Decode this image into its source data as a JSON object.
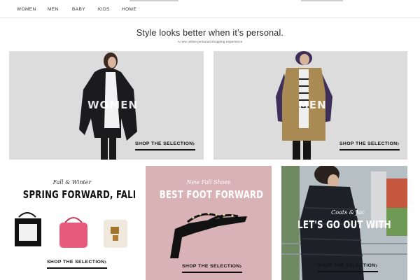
{
  "nav": {
    "items": [
      "WOMEN",
      "MEN",
      "BABY",
      "KIDS",
      "HOME"
    ]
  },
  "hero": {
    "headline": "Style looks better when it’s personal.",
    "subline": "A new online personal shopping experience"
  },
  "panels": {
    "women": {
      "title": "WOMEN",
      "cta": "SHOP THE SELECTION"
    },
    "men": {
      "title": "MEN",
      "cta": "SHOP THE SELECTION"
    }
  },
  "cards": {
    "bags": {
      "script": "Fall & Winter",
      "title": "SPRING FORWARD, FALL BAG",
      "cta": "SHOP THE SELECTION"
    },
    "shoes": {
      "script": "New Fall Shoes",
      "title": "BEST FOOT FORWARD",
      "cta": "SHOP THE SELECTION"
    },
    "coats": {
      "script": "Coats & Jac",
      "title": "LET'S GO OUT WITH",
      "cta": "SHOP THE SELECTION"
    }
  },
  "colors": {
    "panel_gray": "#dcdcdc",
    "shoes_pink": "#d9b2b5",
    "coat_black": "#1b1b1e",
    "coat_tan": "#a98a52",
    "coat_purple": "#3d2f5a",
    "bag_pink": "#e85a7c"
  }
}
